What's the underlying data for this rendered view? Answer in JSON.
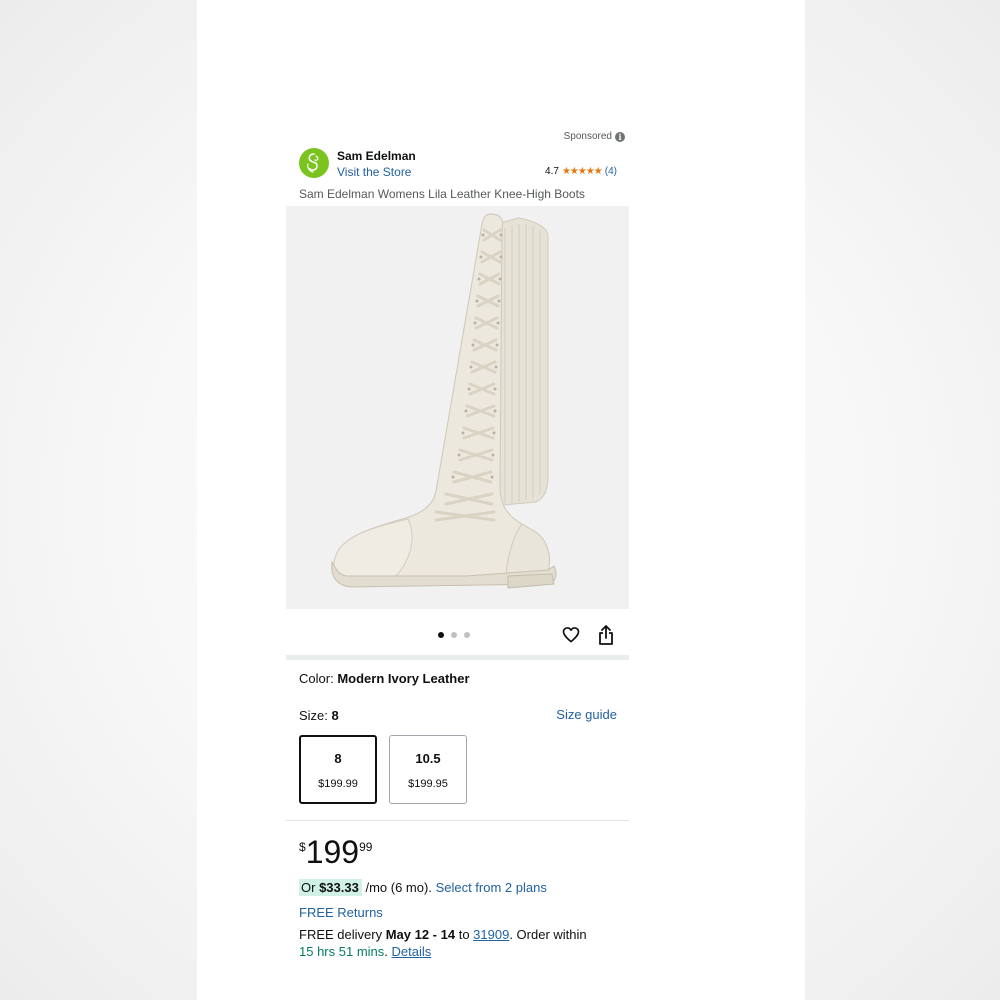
{
  "header": {
    "sponsored_label": "Sponsored",
    "info_icon": "i",
    "brand_name": "Sam Edelman",
    "visit_store": "Visit the Store",
    "rating_value": "4.7",
    "stars": "★★★★★",
    "rating_count": "(4)",
    "rating_fraction": 0.94
  },
  "product": {
    "title": "Sam Edelman Womens Lila Leather Knee-High Boots",
    "image_count": 3,
    "active_image": 1
  },
  "options": {
    "color_label": "Color:",
    "color_value": "Modern Ivory Leather",
    "size_label": "Size:",
    "size_value": "8",
    "size_guide": "Size guide",
    "sizes": [
      {
        "size": "8",
        "price": "$199.99",
        "selected": true
      },
      {
        "size": "10.5",
        "price": "$199.95",
        "selected": false
      }
    ]
  },
  "pricing": {
    "currency_symbol": "$",
    "whole": "199",
    "fraction": "99",
    "installment_prefix": "Or",
    "installment_amount": "$33.33",
    "installment_suffix": "/mo (6 mo).",
    "installment_link": "Select from 2 plans"
  },
  "shipping": {
    "free_returns": "FREE Returns",
    "delivery_prefix": "FREE delivery",
    "delivery_dates": "May 12 - 14",
    "to_word": "to",
    "zip": "31909",
    "order_within": ". Order within",
    "countdown": "15 hrs 51 mins",
    "details_link": "Details"
  },
  "colors": {
    "link": "#2162a1",
    "star": "#e47911",
    "installment_bg": "#d1f1e6",
    "countdown": "#067d62",
    "logo": "#7bc41f"
  }
}
